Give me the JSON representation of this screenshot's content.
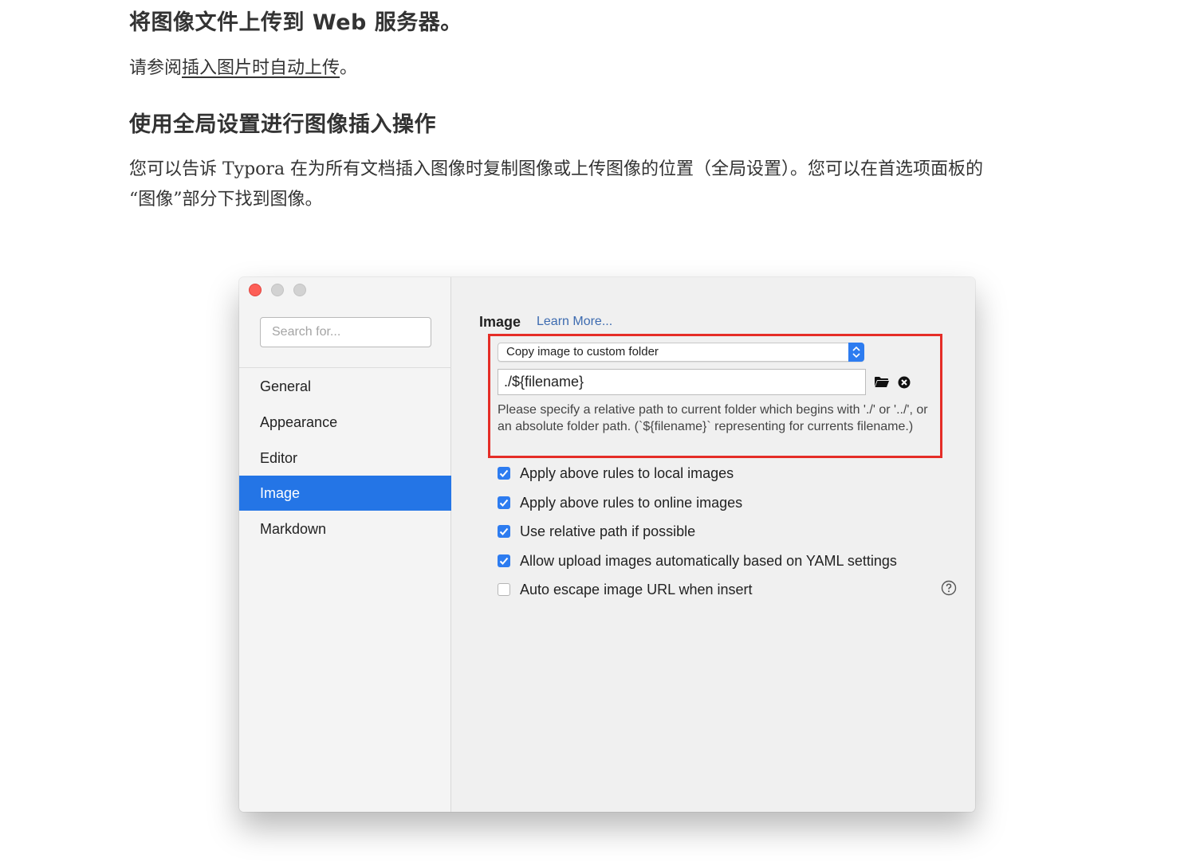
{
  "doc": {
    "heading1": "将图像文件上传到 Web 服务器。",
    "para1_prefix": "请参阅",
    "para1_link": "插入图片时自动上传",
    "para1_suffix": "。",
    "heading2": "使用全局设置进行图像插入操作",
    "para2_line1": "您可以告诉 Typora 在为所有文档插入图像时复制图像或上传图像的位置（全局设置）。您可以在首选项面板的",
    "para2_line2": "“图像”部分下找到图像。"
  },
  "window": {
    "search_placeholder": "Search for...",
    "sidebar": {
      "items": [
        {
          "label": "General",
          "active": false
        },
        {
          "label": "Appearance",
          "active": false
        },
        {
          "label": "Editor",
          "active": false
        },
        {
          "label": "Image",
          "active": true
        },
        {
          "label": "Markdown",
          "active": false
        }
      ]
    },
    "main": {
      "section_title": "Image",
      "learn_more": "Learn More...",
      "select_value": "Copy image to custom folder",
      "path_value": "./${filename}",
      "help_text": " Please specify a relative path to current folder which begins with './' or '../', or an absolute folder path. (`${filename}` representing for currents filename.)",
      "options": [
        {
          "label": "Apply above rules to local images",
          "checked": true
        },
        {
          "label": "Apply above rules to online images",
          "checked": true
        },
        {
          "label": "Use relative path if possible",
          "checked": true
        },
        {
          "label": "Allow upload images automatically based on YAML settings",
          "checked": true
        },
        {
          "label": "Auto escape image URL when insert",
          "checked": false
        }
      ]
    }
  },
  "colors": {
    "accent": "#2475e6",
    "highlight_box": "#e52d27",
    "close_button": "#fd5f57"
  }
}
